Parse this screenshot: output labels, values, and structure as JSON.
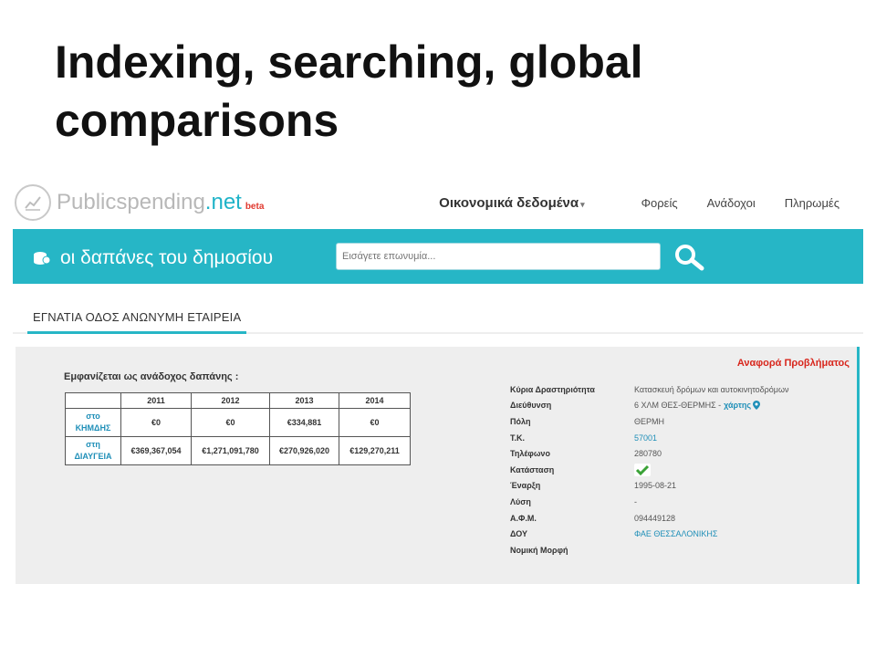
{
  "slide": {
    "title": "Indexing, searching, global comparisons"
  },
  "site": {
    "logo_name": "Publicspending",
    "logo_tld": ".net",
    "logo_beta": "beta",
    "nav": {
      "main": "Οικονομικά δεδομένα",
      "links": [
        "Φορείς",
        "Ανάδοχοι",
        "Πληρωμές"
      ]
    },
    "banner_title": "οι δαπάνες του δημοσίου",
    "search_placeholder": "Εισάγετε επωνυμία...",
    "accent_color": "#26b6c6"
  },
  "entity": {
    "tab_label": "ΕΓΝΑΤΙΑ ΟΔΟΣ ΑΝΩΝΥΜΗ ΕΤΑΙΡΕΙΑ",
    "report_problem": "Αναφορά Προβλήματος",
    "appears_as": "Εμφανίζεται ως ανάδοχος δαπάνης :",
    "table": {
      "years": [
        "2011",
        "2012",
        "2013",
        "2014"
      ],
      "rows": [
        {
          "label_line1": "στο",
          "label_line2": "ΚΗΜΔΗΣ",
          "values": [
            "€0",
            "€0",
            "€334,881",
            "€0"
          ]
        },
        {
          "label_line1": "στη",
          "label_line2": "ΔΙΑΥΓΕΙΑ",
          "values": [
            "€369,367,054",
            "€1,271,091,780",
            "€270,926,020",
            "€129,270,211"
          ]
        }
      ]
    },
    "details": {
      "activity_label": "Κύρια Δραστηριότητα",
      "activity": "Κατασκευή δρόμων και αυτοκινητοδρόμων",
      "address_label": "Διεύθυνση",
      "address": "6 ΧΛΜ ΘΕΣ-ΘΕΡΜΗΣ -",
      "map_link": "χάρτης",
      "city_label": "Πόλη",
      "city": "ΘΕΡΜΗ",
      "zip_label": "Τ.Κ.",
      "zip": "57001",
      "phone_label": "Τηλέφωνο",
      "phone": "280780",
      "status_label": "Κατάσταση",
      "start_label": "Έναρξη",
      "start": "1995-08-21",
      "dissolution_label": "Λύση",
      "dissolution": "-",
      "vat_label": "Α.Φ.Μ.",
      "vat": "094449128",
      "tax_office_label": "ΔΟΥ",
      "tax_office": "ΦΑΕ ΘΕΣΣΑΛΟΝΙΚΗΣ",
      "legal_form_label": "Νομική Μορφή"
    }
  }
}
